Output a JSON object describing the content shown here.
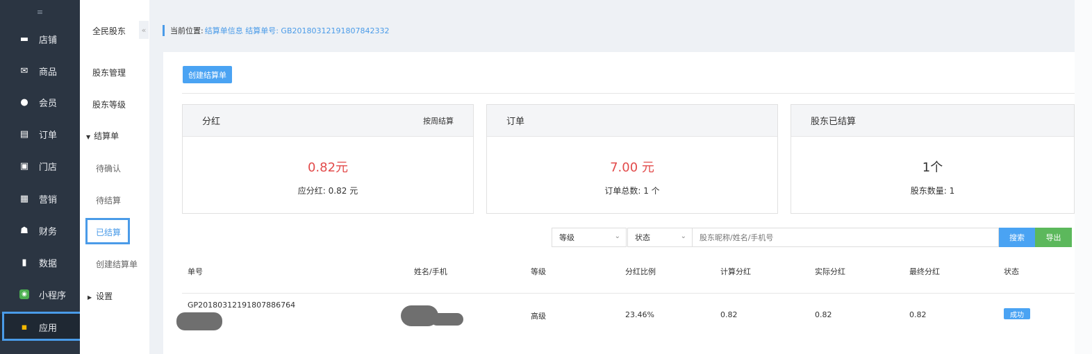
{
  "sidebar": {
    "toggle_icon": "menu-fold-icon",
    "items": [
      {
        "label": "店铺",
        "icon": "shop-icon",
        "glyph": "▬"
      },
      {
        "label": "商品",
        "icon": "goods-icon",
        "glyph": "✉"
      },
      {
        "label": "会员",
        "icon": "member-icon",
        "glyph": "●"
      },
      {
        "label": "订单",
        "icon": "order-icon",
        "glyph": "▤"
      },
      {
        "label": "门店",
        "icon": "store-icon",
        "glyph": "▣"
      },
      {
        "label": "营销",
        "icon": "marketing-icon",
        "glyph": "▦"
      },
      {
        "label": "财务",
        "icon": "finance-icon",
        "glyph": "☗"
      },
      {
        "label": "数据",
        "icon": "data-icon",
        "glyph": "▮"
      },
      {
        "label": "小程序",
        "icon": "miniprogram-icon",
        "glyph": "◉"
      },
      {
        "label": "应用",
        "icon": "app-icon",
        "glyph": "▪"
      }
    ]
  },
  "subnav": {
    "title": "全民股东",
    "collapse_glyph": "«",
    "items": [
      "股东管理",
      "股东等级"
    ],
    "group_settlement": "结算单",
    "settlement_items": [
      "待确认",
      "待结算",
      "已结算",
      "创建结算单"
    ],
    "group_settings": "设置"
  },
  "breadcrumb": {
    "prefix": "当前位置:",
    "link": "结算单信息 结算单号: GB20180312191807842332"
  },
  "toolbar": {
    "create_label": "创建结算单"
  },
  "cards": [
    {
      "title": "分红",
      "sub": "按周结算",
      "big": "0.82元",
      "small": "应分红: 0.82 元"
    },
    {
      "title": "订单",
      "sub": "",
      "big": "7.00 元",
      "small": "订单总数: 1 个"
    },
    {
      "title": "股东已结算",
      "sub": "",
      "big": "1个",
      "small": "股东数量: 1"
    }
  ],
  "filters": {
    "level": "等级",
    "status": "状态",
    "search_placeholder": "股东昵称/姓名/手机号",
    "search_label": "搜索",
    "export_label": "导出"
  },
  "table": {
    "headers": [
      "单号",
      "姓名/手机",
      "等级",
      "分红比例",
      "计算分红",
      "实际分红",
      "最终分红",
      "状态"
    ],
    "row": {
      "order_no": "GP20180312191807886764",
      "level": "高级",
      "ratio": "23.46%",
      "calc": "0.82",
      "actual": "0.82",
      "final": "0.82",
      "status": "成功"
    }
  },
  "colors": {
    "accent": "#4aa3f3",
    "price": "#e24b4b",
    "export": "#5cb85c",
    "sidebar": "#2b3542"
  }
}
